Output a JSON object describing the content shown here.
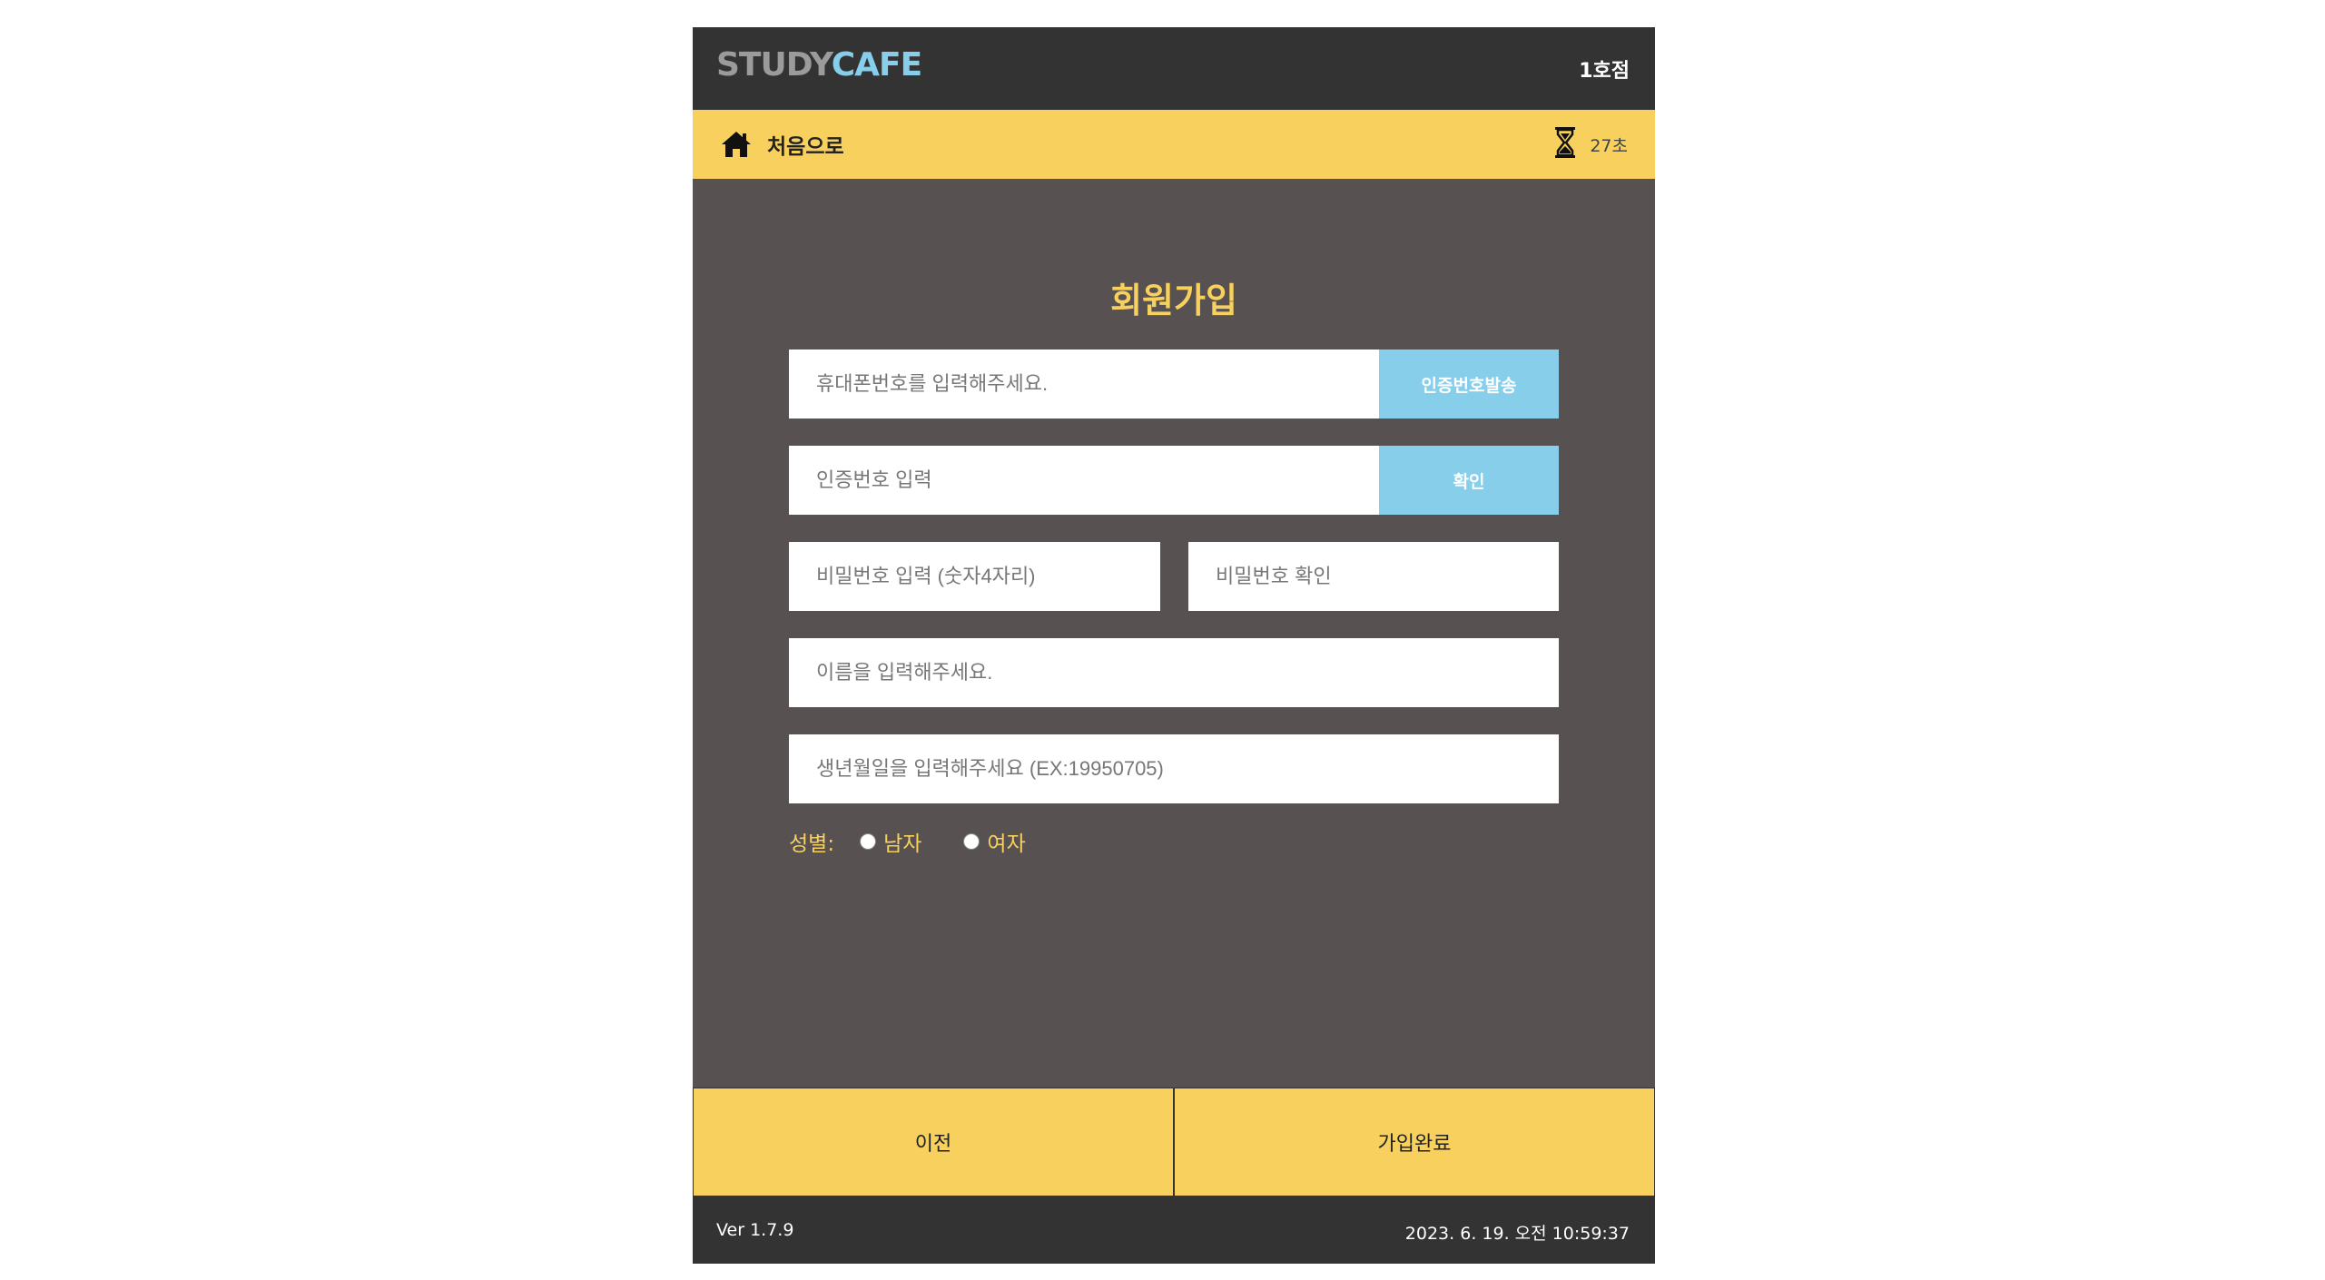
{
  "header": {
    "logo_part1": "STUDY",
    "logo_part2": "CAFE",
    "branch": "1호점"
  },
  "navbar": {
    "home_label": "처음으로",
    "timer_text": "27초"
  },
  "form": {
    "title": "회원가입",
    "phone_placeholder": "휴대폰번호를 입력해주세요.",
    "send_code_label": "인증번호발송",
    "code_placeholder": "인증번호 입력",
    "confirm_label": "확인",
    "password_placeholder": "비밀번호 입력 (숫자4자리)",
    "password_confirm_placeholder": "비밀번호 확인",
    "name_placeholder": "이름을 입력해주세요.",
    "birth_placeholder": "생년월일을 입력해주세요 (EX:19950705)",
    "gender_label": "성별:",
    "gender_options": [
      "남자",
      "여자"
    ]
  },
  "actions": {
    "prev_label": "이전",
    "complete_label": "가입완료"
  },
  "footer": {
    "version": "Ver 1.7.9",
    "datetime": "2023. 6. 19. 오전 10:59:37"
  },
  "colors": {
    "accent_yellow": "#f7d05e",
    "accent_blue": "#87ceeb",
    "panel_bg": "#585151",
    "bar_dark": "#333333"
  },
  "icons": {
    "home": "home-icon",
    "timer": "hourglass-icon"
  }
}
